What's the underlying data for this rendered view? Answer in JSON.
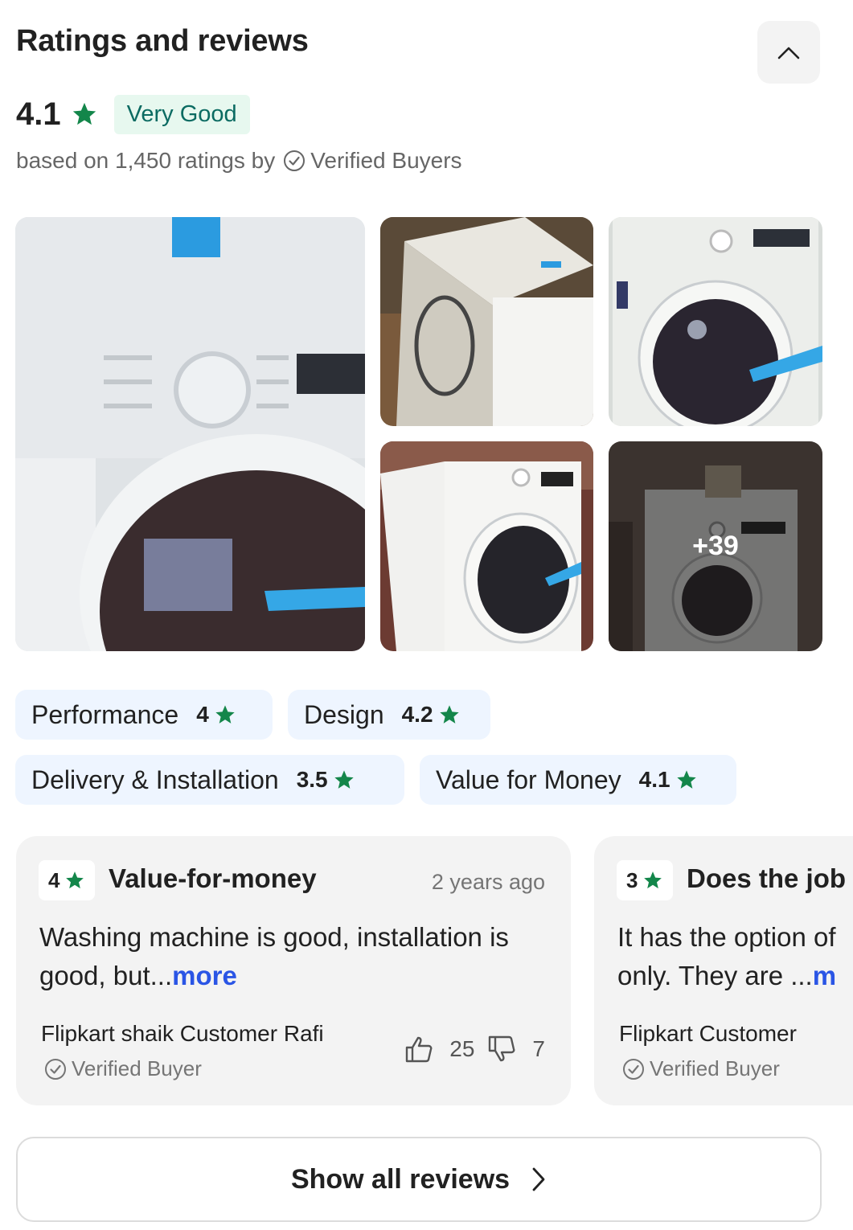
{
  "section": {
    "title": "Ratings and reviews",
    "collapse_icon": "chevron-up-icon"
  },
  "summary": {
    "rating": "4.1",
    "label": "Very Good",
    "based_on": "based on 1,450 ratings by",
    "verified_label": "Verified Buyers"
  },
  "photos": {
    "more_count": "+39"
  },
  "aspects": [
    {
      "name": "Performance",
      "rating": "4"
    },
    {
      "name": "Design",
      "rating": "4.2"
    },
    {
      "name": "Delivery & Installation",
      "rating": "3.5"
    },
    {
      "name": "Value for Money",
      "rating": "4.1"
    }
  ],
  "reviews": [
    {
      "rating": "4",
      "title": "Value-for-money",
      "time": "2 years ago",
      "text": "Washing machine is good, installation is good, but...",
      "more": "more",
      "author": "Flipkart shaik Customer Rafi",
      "verified": "Verified Buyer",
      "likes": "25",
      "dislikes": "7"
    },
    {
      "rating": "3",
      "title": "Does the job",
      "text": "It has the option of only. They are ...",
      "more": "more",
      "author": "Flipkart Customer",
      "verified": "Verified Buyer"
    }
  ],
  "footer": {
    "show_all": "Show all reviews"
  },
  "colors": {
    "star": "#13864a",
    "label_bg": "#e7f8ef",
    "label_text": "#0b6b62",
    "chip_bg": "#eef5ff",
    "link": "#2a55e5"
  }
}
